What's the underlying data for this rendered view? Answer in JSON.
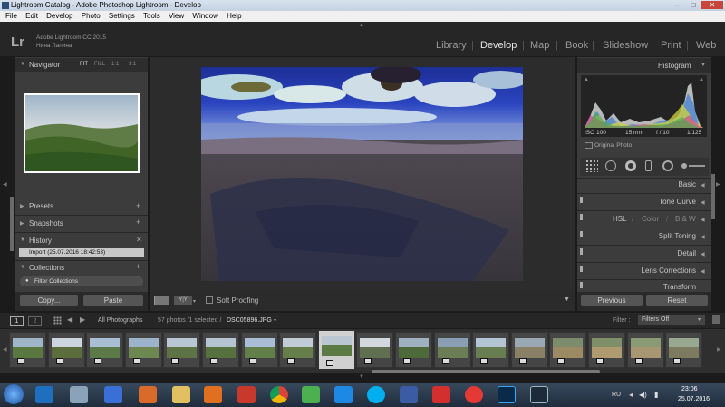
{
  "window": {
    "title": "Lightroom Catalog - Adobe Photoshop Lightroom - Develop",
    "min": "–",
    "max": "□",
    "close": "✕"
  },
  "menu": [
    "File",
    "Edit",
    "Develop",
    "Photo",
    "Settings",
    "Tools",
    "View",
    "Window",
    "Help"
  ],
  "identity": {
    "logo": "Lr",
    "product": "Adobe Lightroom CC 2015",
    "user": "Нина Лапина"
  },
  "modules": [
    "Library",
    "Develop",
    "Map",
    "Book",
    "Slideshow",
    "Print",
    "Web"
  ],
  "active_module": "Develop",
  "left": {
    "navigator": {
      "title": "Navigator",
      "zoom": [
        "FIT",
        "FILL",
        "1:1",
        "3:1"
      ]
    },
    "presets": "Presets",
    "snapshots": "Snapshots",
    "history": {
      "title": "History",
      "item": "Import (25.07.2016 18:42:53)"
    },
    "collections": {
      "title": "Collections",
      "filter": "Filter Collections"
    },
    "copy": "Copy...",
    "paste": "Paste"
  },
  "toolbar": {
    "soft_proofing": "Soft Proofing",
    "view_icon": "Y|Y"
  },
  "right": {
    "histogram": {
      "title": "Histogram",
      "iso": "ISO 100",
      "focal": "15 mm",
      "aperture": "f / 10",
      "shutter": "1/125",
      "original": "Original Photo"
    },
    "sections": [
      "Basic",
      "Tone Curve",
      "Split Toning",
      "Detail",
      "Lens Corrections",
      "Transform"
    ],
    "hsl": {
      "a": "HSL",
      "b": "Color",
      "c": "B & W",
      "sep": "/"
    },
    "previous": "Previous",
    "reset": "Reset"
  },
  "filmstrip": {
    "page1": "1",
    "page2": "2",
    "source": "All Photographs",
    "info": "57 photos /1 selected /",
    "filename": "DSC05896.JPG",
    "filter_label": "Filter :",
    "filter_value": "Filters Off",
    "thumb_count": 18
  },
  "taskbar": {
    "lang": "RU",
    "time": "23:06",
    "date": "25.07.2016"
  },
  "colors": {
    "accent": "#e6e6e6",
    "panel": "#3c3c3c",
    "background": "#1b1b1b"
  }
}
